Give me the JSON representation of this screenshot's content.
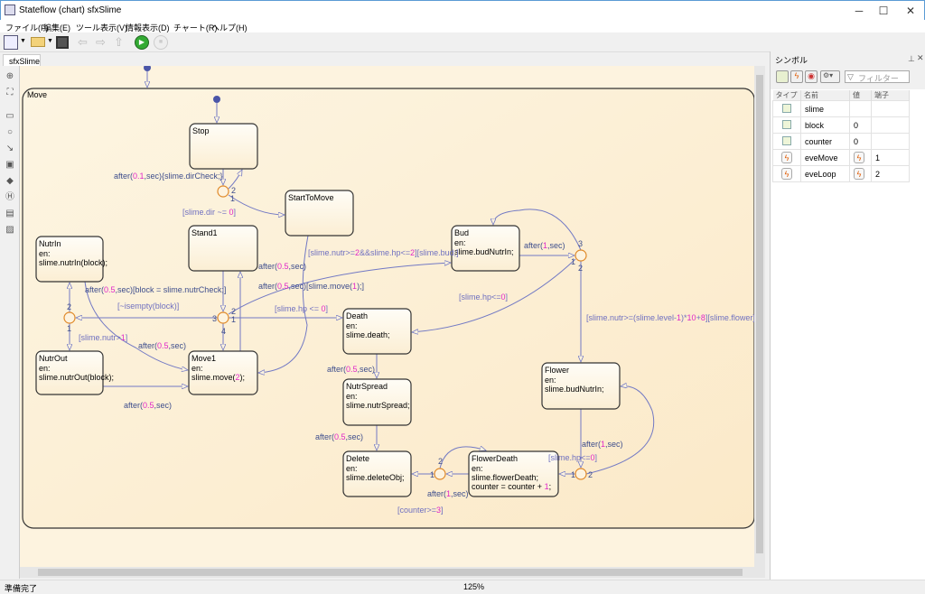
{
  "window": {
    "title": "Stateflow (chart) sfxSlime"
  },
  "menu": [
    "ファイル(F)",
    "編集(E)",
    "ツール表示(V)",
    "情報表示(D)",
    "チャート(R)",
    "ヘルプ(H)"
  ],
  "tab": "sfxSlime",
  "chart": {
    "parent_state": "Move",
    "states": [
      {
        "name": "Stop",
        "lines": []
      },
      {
        "name": "StartToMove",
        "lines": []
      },
      {
        "name": "Stand1",
        "lines": []
      },
      {
        "name": "NutrIn",
        "lines": [
          "en:",
          "slime.nutrIn(block);"
        ]
      },
      {
        "name": "NutrOut",
        "lines": [
          "en:",
          "slime.nutrOut(block);"
        ]
      },
      {
        "name": "Move1",
        "lines": [
          "en:",
          "slime.move(2);"
        ]
      },
      {
        "name": "Bud",
        "lines": [
          "en:",
          "slime.budNutrIn;"
        ]
      },
      {
        "name": "Death",
        "lines": [
          "en:",
          "slime.death;"
        ]
      },
      {
        "name": "NutrSpread",
        "lines": [
          "en:",
          "slime.nutrSpread;"
        ]
      },
      {
        "name": "Delete",
        "lines": [
          "en:",
          "slime.deleteObj;"
        ]
      },
      {
        "name": "FlowerDeath",
        "lines": [
          "en:",
          "slime.flowerDeath;",
          "counter = counter + 1;"
        ]
      },
      {
        "name": "Flower",
        "lines": [
          "en:",
          "slime.budNutrIn;"
        ]
      }
    ],
    "transition_labels": [
      "after(0.1,sec){slime.dirCheck;}",
      "[slime.dir ~= 0]",
      "[slime.nutr>=2&&slime.hp<=2][slime.bud;]",
      "after(0.5,sec)",
      "after(0.5,sec)[slime.move(1);]",
      "[slime.hp <= 0]",
      "[~isempty(block)]",
      "after(0.5,sec)[block = slime.nutrCheck;]",
      "[slime.nutr>1]",
      "after(0.5,sec)",
      "after(0.5,sec)",
      "after(1,sec)",
      "[slime.hp<=0]",
      "[slime.nutr>=(slime.level-1)*10+8][slime.flower]",
      "after(0.5,sec)",
      "after(0.5,sec)",
      "after(1,sec)",
      "[slime.hp<=0]",
      "after(1,sec)",
      "[counter>=3]"
    ],
    "junction_labels": [
      "2",
      "1",
      "2",
      "1",
      "3",
      "4",
      "2",
      "1",
      "3",
      "1",
      "2",
      "2",
      "1",
      "1",
      "2"
    ],
    "colors": {
      "transition": "#7279c4",
      "label": "#3d4d8c",
      "number": "#e026c8",
      "junction": "#e08a2a",
      "state_fill": "#fffaf0"
    }
  },
  "symbols": {
    "title": "シンボル",
    "filter_placeholder": "フィルター",
    "columns": [
      "タイプ",
      "名前",
      "値",
      "端子"
    ],
    "rows": [
      {
        "type": "data",
        "name": "slime",
        "value": "",
        "port": ""
      },
      {
        "type": "data",
        "name": "block",
        "value": "0",
        "port": ""
      },
      {
        "type": "data",
        "name": "counter",
        "value": "0",
        "port": ""
      },
      {
        "type": "event",
        "name": "eveMove",
        "value": "event-icon",
        "port": "1"
      },
      {
        "type": "event",
        "name": "eveLoop",
        "value": "event-icon",
        "port": "2"
      }
    ]
  },
  "status": {
    "text": "準備完了",
    "zoom": "125%"
  }
}
